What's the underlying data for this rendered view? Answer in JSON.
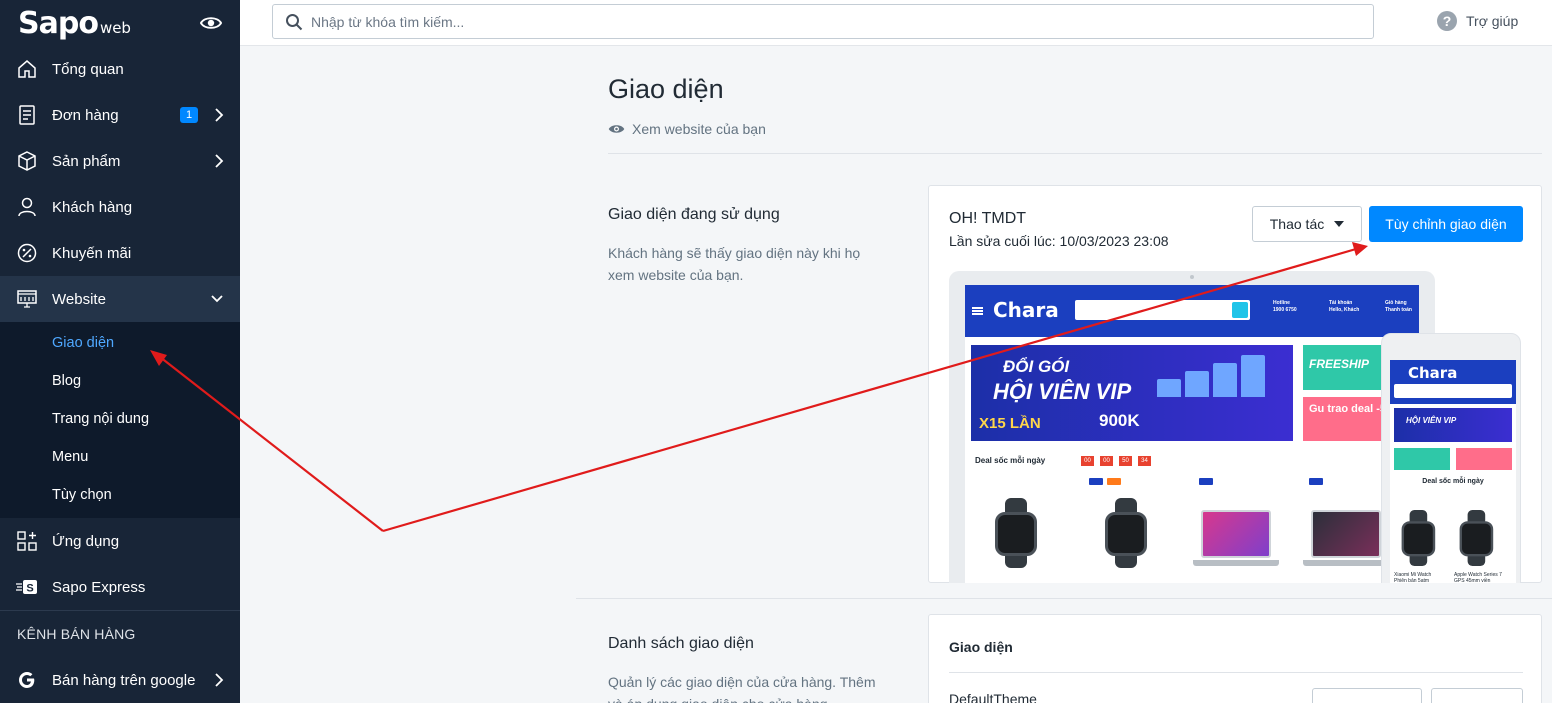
{
  "brand": {
    "logo": "Sapo",
    "logo_suffix": "web"
  },
  "topbar": {
    "search_placeholder": "Nhập từ khóa tìm kiếm...",
    "help_label": "Trợ giúp"
  },
  "sidebar": {
    "items": [
      {
        "label": "Tổng quan",
        "icon": "home-icon"
      },
      {
        "label": "Đơn hàng",
        "icon": "receipt-icon",
        "badge": "1"
      },
      {
        "label": "Sản phẩm",
        "icon": "box-icon"
      },
      {
        "label": "Khách hàng",
        "icon": "user-icon"
      },
      {
        "label": "Khuyến mãi",
        "icon": "percent-icon"
      },
      {
        "label": "Website",
        "icon": "monitor-icon"
      }
    ],
    "website_sub": [
      "Giao diện",
      "Blog",
      "Trang nội dung",
      "Menu",
      "Tùy chọn"
    ],
    "apps": {
      "label": "Ứng dụng",
      "icon": "apps-icon"
    },
    "express": {
      "label": "Sapo Express",
      "icon": "express-icon"
    },
    "channels_label": "KÊNH BÁN HÀNG",
    "google": {
      "label": "Bán hàng trên google",
      "icon": "google-icon"
    }
  },
  "main": {
    "title": "Giao diện",
    "view_link": "Xem website của bạn",
    "current": {
      "title": "Giao diện đang sử dụng",
      "desc": "Khách hàng sẽ thấy giao diện này khi họ xem website của bạn.",
      "theme_name": "OH! TMDT",
      "last_edit": "Lần sửa cuối lúc: 10/03/2023 23:08",
      "actions_label": "Thao tác",
      "customize_label": "Tùy chỉnh giao diện"
    },
    "list": {
      "title": "Danh sách giao diện",
      "desc": "Quản lý các giao diện của cửa hàng. Thêm và áp dụng giao diện cho cửa hàng.",
      "card_title": "Giao diện",
      "default_theme": "DefaultTheme"
    }
  },
  "preview": {
    "shop_logo": "Chara",
    "hotline_label": "Hotline",
    "hotline": "1900 6750",
    "account_label": "Tài khoản",
    "account_sub": "Hello, Khách",
    "cart_label": "Giỏ hàng",
    "cart_sub": "Thanh toán",
    "banner_line1": "ĐỔI GÓI",
    "banner_line2": "HỘI VIÊN VIP",
    "banner_x15": "X15 LẦN",
    "banner_price": "900K",
    "side_banner1": "FREESHIP",
    "side_banner2": "Gu trao deal -50%",
    "deal_title": "Deal sốc mỗi ngày",
    "countdown": [
      "00",
      "00",
      "50",
      "34"
    ],
    "phone_deal_title": "Deal sốc mỗi ngày",
    "phone_prod1": "Xiaomi Mi Watch Phiên bản 5atm",
    "phone_prod2": "Apple Watch Series 7 GPS 45mm viền"
  },
  "colors": {
    "sidebar": "#182537",
    "primary": "#0088ff",
    "annotation": "#e01b1b"
  }
}
